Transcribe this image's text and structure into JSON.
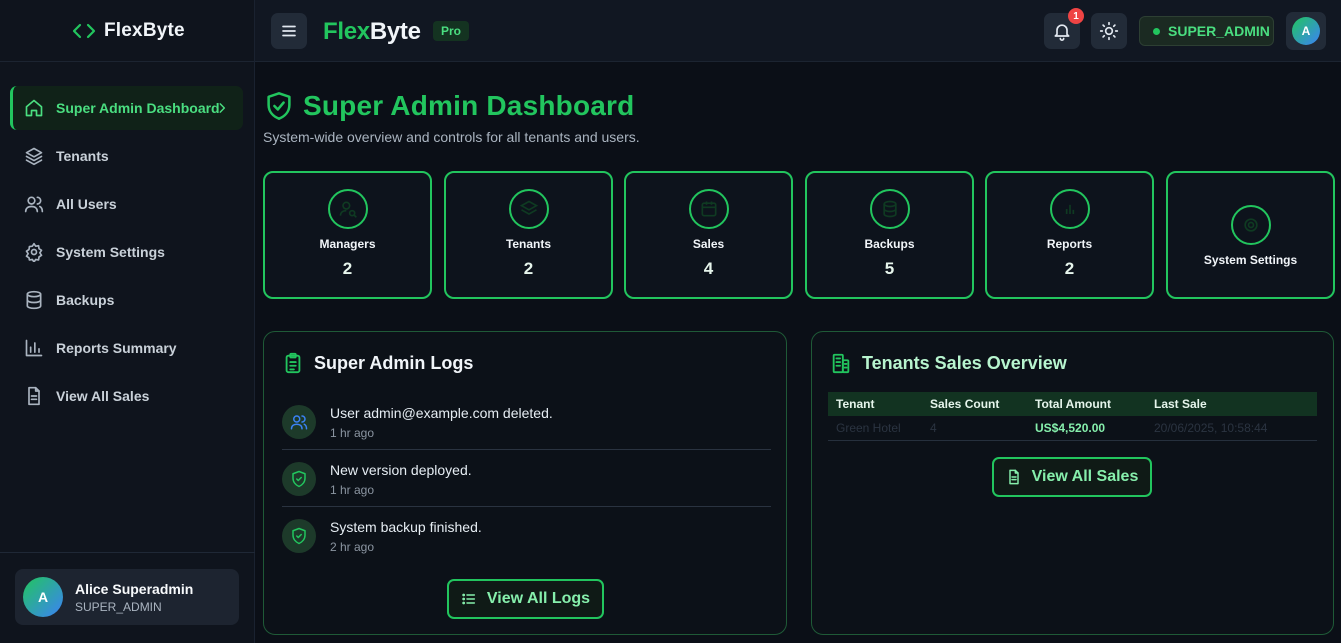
{
  "sidebar": {
    "brand": "FlexByte",
    "items": [
      {
        "label": "Super Admin Dashboard",
        "icon": "home-icon",
        "active": true
      },
      {
        "label": "Tenants",
        "icon": "layers-icon"
      },
      {
        "label": "All Users",
        "icon": "users-icon"
      },
      {
        "label": "System Settings",
        "icon": "gear-icon"
      },
      {
        "label": "Backups",
        "icon": "database-icon"
      },
      {
        "label": "Reports Summary",
        "icon": "bar-chart-icon"
      },
      {
        "label": "View All Sales",
        "icon": "document-icon"
      }
    ],
    "user": {
      "initial": "A",
      "name": "Alice Superadmin",
      "role": "SUPER_ADMIN"
    }
  },
  "header": {
    "logo_part1": "Flex",
    "logo_part2": "Byte",
    "badge": "Pro",
    "notification_count": "1",
    "role": "SUPER_ADMIN",
    "avatar_initial": "A"
  },
  "page": {
    "title": "Super Admin Dashboard",
    "subtitle": "System-wide overview and controls for all tenants and users."
  },
  "stats": [
    {
      "label": "Managers",
      "value": "2",
      "icon": "user-search-icon"
    },
    {
      "label": "Tenants",
      "value": "2",
      "icon": "layers-icon"
    },
    {
      "label": "Sales",
      "value": "4",
      "icon": "calendar-icon"
    },
    {
      "label": "Backups",
      "value": "5",
      "icon": "database-icon"
    },
    {
      "label": "Reports",
      "value": "2",
      "icon": "chart-icon"
    },
    {
      "label": "System Settings",
      "icon": "gear-icon"
    }
  ],
  "logs": {
    "title": "Super Admin Logs",
    "items": [
      {
        "text": "User admin@example.com deleted.",
        "time": "1 hr ago",
        "icon": "users-icon"
      },
      {
        "text": "New version deployed.",
        "time": "1 hr ago",
        "icon": "shield-check-icon"
      },
      {
        "text": "System backup finished.",
        "time": "2 hr ago",
        "icon": "shield-check-icon"
      }
    ],
    "button": "View All Logs"
  },
  "sales_overview": {
    "title": "Tenants Sales Overview",
    "columns": [
      "Tenant",
      "Sales Count",
      "Total Amount",
      "Last Sale"
    ],
    "rows": [
      {
        "tenant": "Green Hotel",
        "count": "4",
        "amount": "US$4,520.00",
        "last_sale": "20/06/2025, 10:58:44"
      }
    ],
    "button": "View All Sales"
  },
  "colors": {
    "accent": "#22c55e",
    "background": "#0b0f17",
    "danger": "#ef4444"
  }
}
